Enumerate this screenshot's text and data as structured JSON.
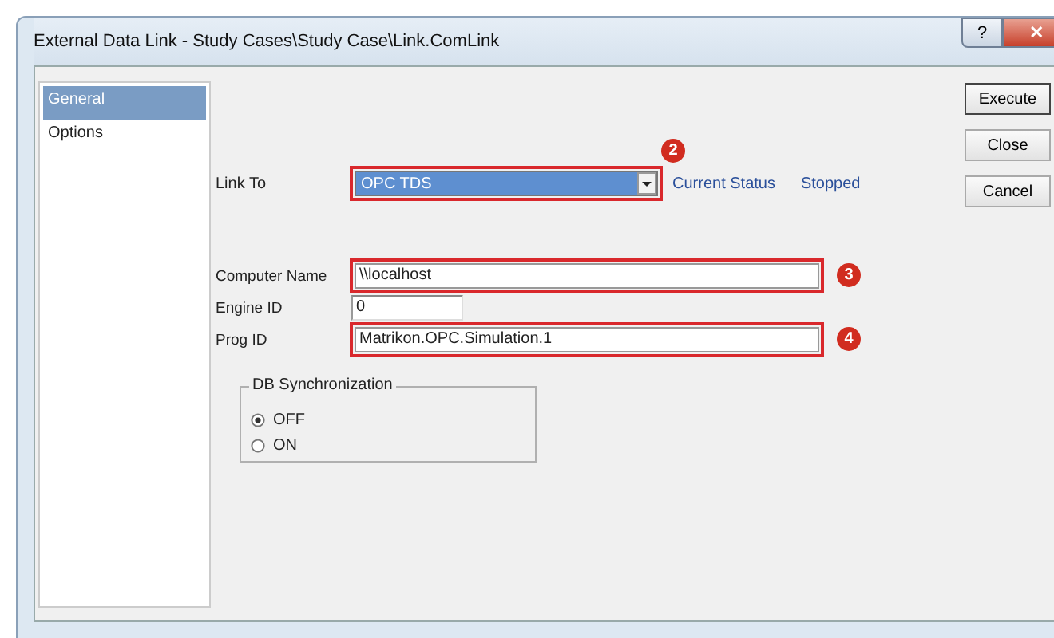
{
  "window": {
    "title": "External Data Link - Study Cases\\Study Case\\Link.ComLink",
    "help": "?",
    "close": "✕"
  },
  "sidebar": {
    "items": [
      {
        "label": "General",
        "selected": true
      },
      {
        "label": "Options",
        "selected": false
      }
    ]
  },
  "link_to": {
    "label": "Link To",
    "value": "OPC TDS",
    "highlighted": true,
    "callout": "2"
  },
  "status": {
    "label": "Current Status",
    "value": "Stopped"
  },
  "fields": [
    {
      "label": "Computer Name",
      "value": "\\\\localhost",
      "highlighted": true,
      "callout": "3"
    },
    {
      "label": "Engine ID",
      "value": "0",
      "highlighted": false
    },
    {
      "label": "Prog ID",
      "value": "Matrikon.OPC.Simulation.1",
      "highlighted": true,
      "callout": "4"
    }
  ],
  "db_sync": {
    "title": "DB Synchronization",
    "options": [
      {
        "label": "OFF",
        "selected": true
      },
      {
        "label": "ON",
        "selected": false
      }
    ]
  },
  "buttons": [
    {
      "label": "Execute",
      "default": true
    },
    {
      "label": "Close",
      "default": false
    },
    {
      "label": "Cancel",
      "default": false
    }
  ]
}
